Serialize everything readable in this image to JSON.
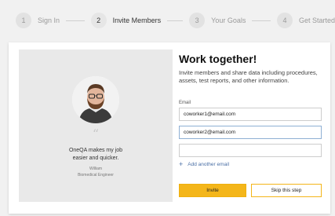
{
  "stepper": {
    "steps": [
      {
        "num": "1",
        "label": "Sign In"
      },
      {
        "num": "2",
        "label": "Invite Members"
      },
      {
        "num": "3",
        "label": "Your Goals"
      },
      {
        "num": "4",
        "label": "Get Started"
      }
    ],
    "active_step": 2
  },
  "testimonial": {
    "quote_mark": "“",
    "quote_line1": "OneQA makes my job",
    "quote_line2": "easier and quicker.",
    "author_name": "William",
    "author_title": "Biomedical Engineer"
  },
  "form": {
    "title": "Work together!",
    "description": "Invite members and share data including procedures, assets, test reports, and other information.",
    "email_label": "Email",
    "emails": [
      {
        "value": "coworker1@email.com"
      },
      {
        "value": "coworker2@email.com"
      },
      {
        "value": ""
      }
    ],
    "add_email_icon": "+",
    "add_email_label": "Add another email",
    "invite_label": "Invite",
    "skip_label": "Skip this step"
  },
  "colors": {
    "accent": "#f4b61a",
    "link": "#4a6fa5"
  }
}
